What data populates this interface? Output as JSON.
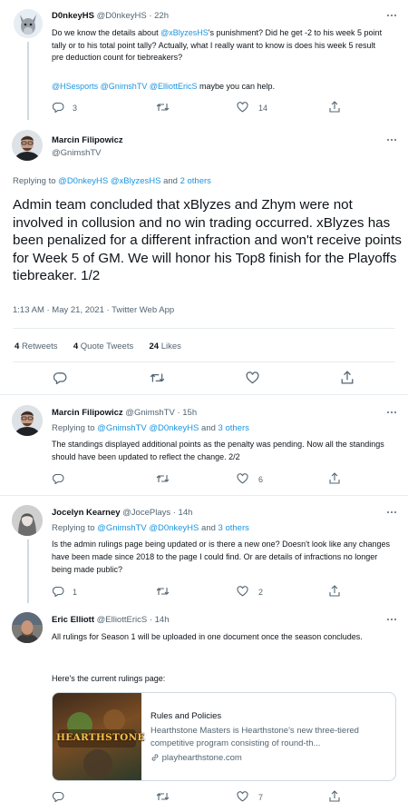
{
  "tweet1": {
    "name": "D0nkeyHS",
    "handle": "@D0nkeyHS",
    "time": "· 22h",
    "text_pre": "Do we know the details about ",
    "text_mention": "@xBlyzesHS",
    "text_post": "'s punishment? Did he get -2 to his week 5 point tally or to his total point tally? Actually, what I really want to know is does his week 5 result pre deduction count for tiebreakers?",
    "mentions": [
      "@HSesports",
      "@GnimshTV",
      "@ElliottEricS"
    ],
    "mentions_tail": "maybe you can help.",
    "replies": "3",
    "likes": "14"
  },
  "main": {
    "name": "Marcin Filipowicz",
    "handle": "@GnimshTV",
    "replying_label": "Replying to",
    "replying_users": "@D0nkeyHS @xBlyzesHS",
    "replying_and": "and",
    "replying_others": "2 others",
    "text": "Admin team concluded that xBlyzes and Zhym were not involved in collusion and no win trading occurred. xBlyzes has been penalized for a different infraction and won't receive points for Week 5 of GM. We will honor his Top8 finish for the Playoffs tiebreaker. 1/2",
    "meta": "1:13 AM · May 21, 2021 · Twitter Web App",
    "retweets_count": "4",
    "retweets_label": "Retweets",
    "quotes_count": "4",
    "quotes_label": "Quote Tweets",
    "likes_count": "24",
    "likes_label": "Likes"
  },
  "reply1": {
    "name": "Marcin Filipowicz",
    "handle": "@GnimshTV",
    "time": "· 15h",
    "replying_label": "Replying to",
    "replying_users": "@GnimshTV @D0nkeyHS",
    "replying_and": "and",
    "replying_others": "3 others",
    "text": "The standings displayed additional points as the penalty was pending. Now all the standings should have been updated to reflect the change. 2/2",
    "likes": "6"
  },
  "reply2": {
    "name": "Jocelyn Kearney",
    "handle": "@JocePlays",
    "time": "· 14h",
    "replying_label": "Replying to",
    "replying_users": "@GnimshTV @D0nkeyHS",
    "replying_and": "and",
    "replying_others": "3 others",
    "text": "Is the admin rulings page being updated or is there a new one? Doesn't look like any changes have been made since 2018 to the page I could find. Or are details of infractions no longer being made public?",
    "replies": "1",
    "likes": "2"
  },
  "reply3": {
    "name": "Eric Elliott",
    "handle": "@ElliottEricS",
    "time": "· 14h",
    "text1": "All rulings for Season 1 will be uploaded in one document once the season concludes.",
    "text2": "Here's the current rulings page:",
    "card_title": "Rules and Policies",
    "card_desc": "Hearthstone Masters is Hearthstone's new three-tiered competitive program consisting of round-th...",
    "card_domain": "playhearthstone.com",
    "card_logo": "HEARTHSTONE",
    "likes": "7"
  },
  "colors": {
    "link": "#1b95e0",
    "muted": "#536471",
    "border": "#e6ecf0"
  }
}
